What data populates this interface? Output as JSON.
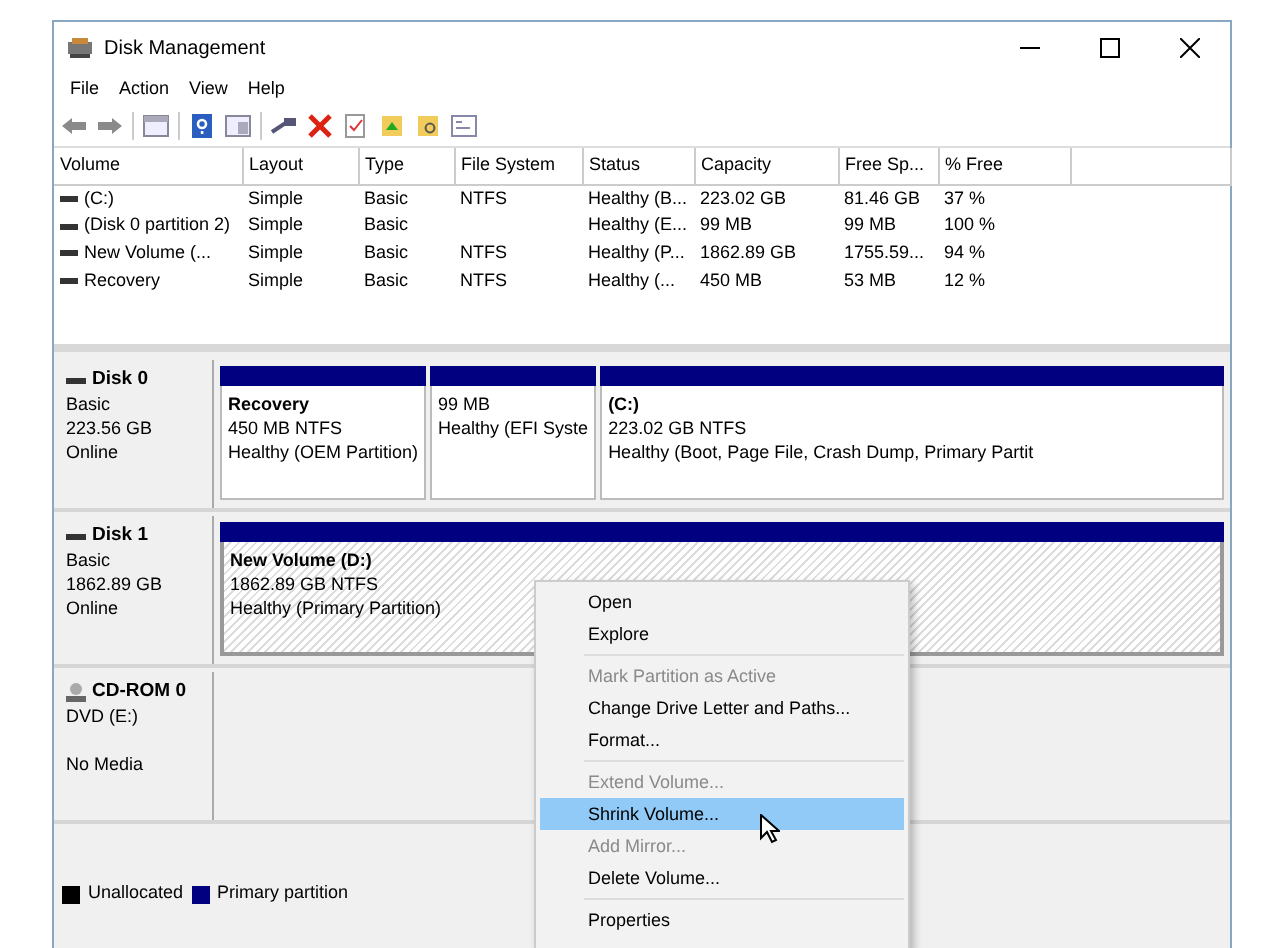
{
  "window": {
    "title": "Disk Management"
  },
  "menu_bar": [
    "File",
    "Action",
    "View",
    "Help"
  ],
  "volume_table": {
    "columns": [
      "Volume",
      "Layout",
      "Type",
      "File System",
      "Status",
      "Capacity",
      "Free Sp...",
      "% Free"
    ],
    "rows": [
      {
        "cells": [
          "(C:)",
          "Simple",
          "Basic",
          "NTFS",
          "Healthy (B...",
          "223.02 GB",
          "81.46 GB",
          "37 %"
        ]
      },
      {
        "cells": [
          "(Disk 0 partition 2)",
          "Simple",
          "Basic",
          "",
          "Healthy (E...",
          "99 MB",
          "99 MB",
          "100 %"
        ]
      },
      {
        "cells": [
          "New Volume (...",
          "Simple",
          "Basic",
          "NTFS",
          "Healthy (P...",
          "1862.89 GB",
          "1755.59...",
          "94 %"
        ]
      },
      {
        "cells": [
          "Recovery",
          "Simple",
          "Basic",
          "NTFS",
          "Healthy (...",
          "450 MB",
          "53 MB",
          "12 %"
        ]
      }
    ]
  },
  "disks": [
    {
      "kind": "disk",
      "name": "Disk 0",
      "lines": [
        "Basic",
        "223.56 GB",
        "Online"
      ],
      "partitions": [
        {
          "name": "Recovery",
          "size": "450 MB NTFS",
          "status": "Healthy (OEM Partition)",
          "selected": false,
          "color": "#000080"
        },
        {
          "size": "99 MB",
          "status": "Healthy (EFI Syste",
          "selected": false,
          "color": "#000080"
        },
        {
          "name": "(C:)",
          "size": "223.02 GB NTFS",
          "status": "Healthy (Boot, Page File, Crash Dump, Primary Partit",
          "selected": false,
          "color": "#000080"
        }
      ]
    },
    {
      "kind": "disk",
      "name": "Disk 1",
      "lines": [
        "Basic",
        "1862.89 GB",
        "Online"
      ],
      "partitions": [
        {
          "name": "New Volume  (D:)",
          "size": "1862.89 GB NTFS",
          "status": "Healthy (Primary Partition)",
          "selected": true,
          "color": "#000080"
        }
      ]
    },
    {
      "kind": "cdrom",
      "name": "CD-ROM 0",
      "lines": [
        "DVD (E:)",
        "No Media"
      ]
    }
  ],
  "legend": [
    {
      "label": "Unallocated",
      "color": "#000000"
    },
    {
      "label": "Primary partition",
      "color": "#000080"
    }
  ],
  "context_menu": [
    [
      {
        "label": "Open",
        "disabled": false,
        "selected": false
      },
      {
        "label": "Explore",
        "disabled": false,
        "selected": false
      }
    ],
    [
      {
        "label": "Mark Partition as Active",
        "disabled": true,
        "selected": false
      },
      {
        "label": "Change Drive Letter and Paths...",
        "disabled": false,
        "selected": false
      },
      {
        "label": "Format...",
        "disabled": false,
        "selected": false
      }
    ],
    [
      {
        "label": "Extend Volume...",
        "disabled": true,
        "selected": false
      },
      {
        "label": "Shrink Volume...",
        "disabled": false,
        "selected": true
      },
      {
        "label": "Add Mirror...",
        "disabled": true,
        "selected": false
      },
      {
        "label": "Delete Volume...",
        "disabled": false,
        "selected": false
      }
    ],
    [
      {
        "label": "Properties",
        "disabled": false,
        "selected": false
      }
    ]
  ]
}
